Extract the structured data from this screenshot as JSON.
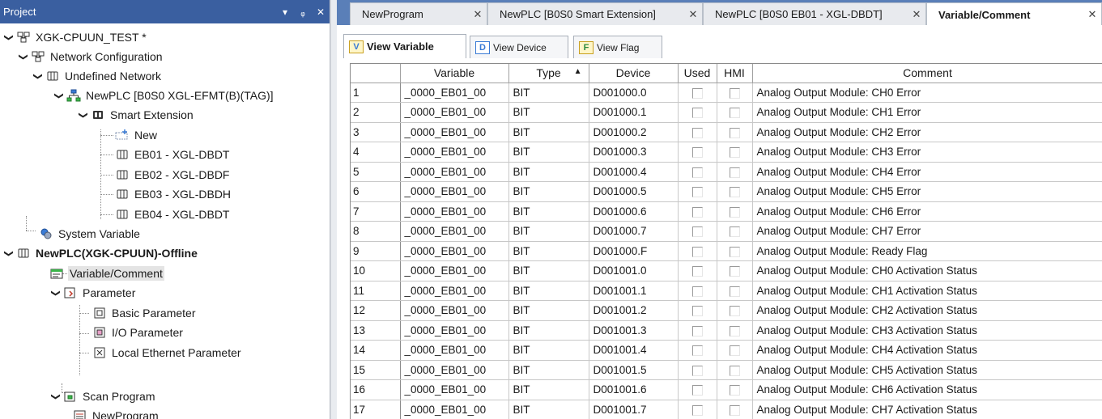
{
  "project": {
    "header_title": "Project",
    "header_buttons": {
      "dropdown": "▾",
      "pin": "ᵩ",
      "close": "✕"
    },
    "tree": [
      {
        "label": "XGK-CPUUN_TEST *",
        "icon": "project-icon"
      },
      {
        "label": "Network Configuration",
        "icon": "network-config-icon"
      },
      {
        "label": "Undefined Network",
        "icon": "network-icon"
      },
      {
        "label": "NewPLC [B0S0 XGL-EFMT(B)(TAG)]",
        "icon": "plc-network-icon"
      },
      {
        "label": "Smart Extension",
        "icon": "smart-extension-icon"
      },
      {
        "label": "New",
        "icon": "new-item-icon"
      },
      {
        "label": "EB01 - XGL-DBDT",
        "icon": "module-icon"
      },
      {
        "label": "EB02 - XGL-DBDF",
        "icon": "module-icon"
      },
      {
        "label": "EB03 - XGL-DBDH",
        "icon": "module-icon"
      },
      {
        "label": "EB04 - XGL-DBDT",
        "icon": "module-icon"
      },
      {
        "label": "System Variable",
        "icon": "system-variable-icon"
      },
      {
        "label": "NewPLC(XGK-CPUUN)-Offline",
        "icon": "plc-icon"
      },
      {
        "label": "Variable/Comment",
        "icon": "variable-comment-icon"
      },
      {
        "label": "Parameter",
        "icon": "parameter-icon"
      },
      {
        "label": "Basic Parameter",
        "icon": "basic-parameter-icon"
      },
      {
        "label": "I/O Parameter",
        "icon": "io-parameter-icon"
      },
      {
        "label": "Local Ethernet Parameter",
        "icon": "ethernet-parameter-icon"
      },
      {
        "label": "Scan Program",
        "icon": "scan-program-icon"
      },
      {
        "label": "NewProgram",
        "icon": "program-icon"
      }
    ]
  },
  "doc_tabs": [
    {
      "label": "NewProgram",
      "close": "✕"
    },
    {
      "label": "NewPLC [B0S0 Smart Extension]",
      "close": "✕"
    },
    {
      "label": "NewPLC [B0S0 EB01 - XGL-DBDT]",
      "close": "✕"
    },
    {
      "label": "Variable/Comment",
      "close": "✕"
    }
  ],
  "sub_tabs": [
    {
      "label": "View Variable",
      "icon_glyph": "V"
    },
    {
      "label": "View Device",
      "icon_glyph": "D"
    },
    {
      "label": "View Flag",
      "icon_glyph": "F"
    }
  ],
  "table": {
    "columns": [
      "",
      "Variable",
      "Type",
      "Device",
      "Used",
      "HMI",
      "Comment"
    ],
    "sort_indicator": "▲",
    "rows": [
      {
        "num": "1",
        "variable": "_0000_EB01_00",
        "type": "BIT",
        "device": "D001000.0",
        "comment": "Analog Output Module: CH0 Error"
      },
      {
        "num": "2",
        "variable": "_0000_EB01_00",
        "type": "BIT",
        "device": "D001000.1",
        "comment": "Analog Output Module: CH1 Error"
      },
      {
        "num": "3",
        "variable": "_0000_EB01_00",
        "type": "BIT",
        "device": "D001000.2",
        "comment": "Analog Output Module: CH2 Error"
      },
      {
        "num": "4",
        "variable": "_0000_EB01_00",
        "type": "BIT",
        "device": "D001000.3",
        "comment": "Analog Output Module: CH3 Error"
      },
      {
        "num": "5",
        "variable": "_0000_EB01_00",
        "type": "BIT",
        "device": "D001000.4",
        "comment": "Analog Output Module: CH4 Error"
      },
      {
        "num": "6",
        "variable": "_0000_EB01_00",
        "type": "BIT",
        "device": "D001000.5",
        "comment": "Analog Output Module: CH5 Error"
      },
      {
        "num": "7",
        "variable": "_0000_EB01_00",
        "type": "BIT",
        "device": "D001000.6",
        "comment": "Analog Output Module: CH6 Error"
      },
      {
        "num": "8",
        "variable": "_0000_EB01_00",
        "type": "BIT",
        "device": "D001000.7",
        "comment": "Analog Output Module: CH7 Error"
      },
      {
        "num": "9",
        "variable": "_0000_EB01_00",
        "type": "BIT",
        "device": "D001000.F",
        "comment": "Analog Output Module: Ready Flag"
      },
      {
        "num": "10",
        "variable": "_0000_EB01_00",
        "type": "BIT",
        "device": "D001001.0",
        "comment": "Analog Output Module: CH0 Activation Status"
      },
      {
        "num": "11",
        "variable": "_0000_EB01_00",
        "type": "BIT",
        "device": "D001001.1",
        "comment": "Analog Output Module: CH1 Activation Status"
      },
      {
        "num": "12",
        "variable": "_0000_EB01_00",
        "type": "BIT",
        "device": "D001001.2",
        "comment": "Analog Output Module: CH2 Activation Status"
      },
      {
        "num": "13",
        "variable": "_0000_EB01_00",
        "type": "BIT",
        "device": "D001001.3",
        "comment": "Analog Output Module: CH3 Activation Status"
      },
      {
        "num": "14",
        "variable": "_0000_EB01_00",
        "type": "BIT",
        "device": "D001001.4",
        "comment": "Analog Output Module: CH4 Activation Status"
      },
      {
        "num": "15",
        "variable": "_0000_EB01_00",
        "type": "BIT",
        "device": "D001001.5",
        "comment": "Analog Output Module: CH5 Activation Status"
      },
      {
        "num": "16",
        "variable": "_0000_EB01_00",
        "type": "BIT",
        "device": "D001001.6",
        "comment": "Analog Output Module: CH6 Activation Status"
      },
      {
        "num": "17",
        "variable": "_0000_EB01_00",
        "type": "BIT",
        "device": "D001001.7",
        "comment": "Analog Output Module: CH7 Activation Status"
      }
    ]
  },
  "colors": {
    "project_header_bg": "#3a5fa0",
    "doc_tabs_bar_bg": "#5a7fb8",
    "selected_item_bg": "#e4e4e4"
  }
}
